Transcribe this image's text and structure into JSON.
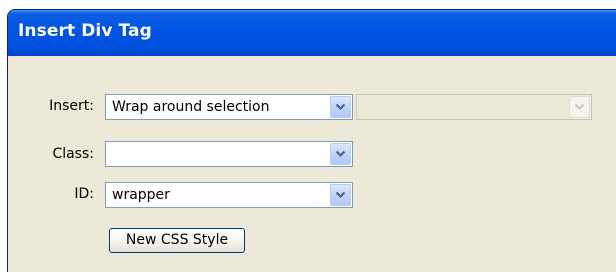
{
  "dialog": {
    "title": "Insert Div Tag"
  },
  "form": {
    "insert": {
      "label": "Insert:",
      "value": "Wrap around selection",
      "secondary_value": ""
    },
    "class": {
      "label": "Class:",
      "value": ""
    },
    "id": {
      "label": "ID:",
      "value": "wrapper"
    }
  },
  "buttons": {
    "new_css_style": "New CSS Style"
  },
  "icons": {
    "dropdown": "chevron-down-icon"
  },
  "colors": {
    "titlebar": "#0054e3",
    "dialog_bg": "#ece9d8",
    "field_border": "#7f9db9"
  }
}
